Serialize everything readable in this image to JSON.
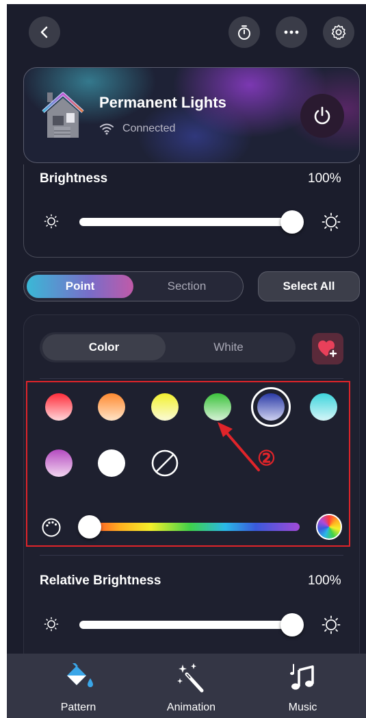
{
  "header": {
    "back_icon": "chevron-left-icon",
    "timer_icon": "stopwatch-icon",
    "more_icon": "ellipsis-icon",
    "settings_icon": "gear-icon"
  },
  "device": {
    "name": "Permanent Lights",
    "status": "Connected",
    "power_icon": "power-icon",
    "image": "house-icon"
  },
  "brightness": {
    "label": "Brightness",
    "value": "100%",
    "level": 1.0
  },
  "mode_toggle": {
    "options": [
      "Point",
      "Section"
    ],
    "selected": "Point"
  },
  "select_all_label": "Select All",
  "color_white_toggle": {
    "options": [
      "Color",
      "White"
    ],
    "selected": "Color"
  },
  "favorite_icon": "heart-plus-icon",
  "swatches": [
    {
      "name": "red",
      "top": "#ff2d3a",
      "bottom": "#ffd6da"
    },
    {
      "name": "orange",
      "top": "#ff8a30",
      "bottom": "#ffe4c8"
    },
    {
      "name": "yellow",
      "top": "#f2f02e",
      "bottom": "#fbfbd6"
    },
    {
      "name": "green",
      "top": "#3cc23c",
      "bottom": "#d6f2d6"
    },
    {
      "name": "blue",
      "top": "#2a3aa6",
      "bottom": "#cfd2f0",
      "selected": true
    },
    {
      "name": "cyan",
      "top": "#3ed4dc",
      "bottom": "#d6f6f8"
    },
    {
      "name": "purple",
      "top": "#b44ac0",
      "bottom": "#f2d6f0"
    },
    {
      "name": "white",
      "top": "#ffffff",
      "bottom": "#ffffff"
    },
    {
      "name": "none",
      "top": "none",
      "bottom": "none"
    }
  ],
  "hue_slider": {
    "position": 0.0,
    "palette_icon": "palette-icon",
    "spectrum_icon": "rainbow-wheel-icon"
  },
  "annotation": {
    "label": "②",
    "color": "#e0242a"
  },
  "relative_brightness": {
    "label": "Relative Brightness",
    "value": "100%",
    "level": 1.0
  },
  "tabs": [
    {
      "label": "Pattern",
      "icon": "paint-bucket-icon"
    },
    {
      "label": "Animation",
      "icon": "magic-wand-icon"
    },
    {
      "label": "Music",
      "icon": "music-note-icon"
    }
  ]
}
